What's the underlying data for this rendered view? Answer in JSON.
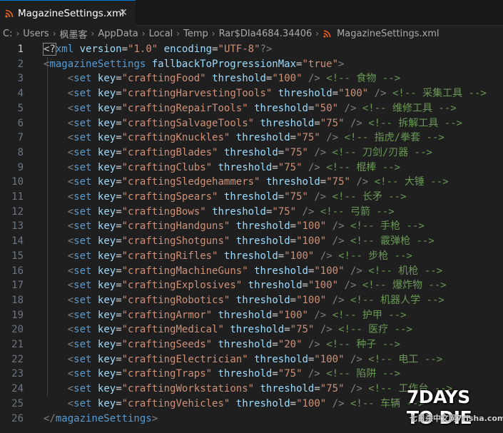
{
  "tab": {
    "title": "MagazineSettings.xml",
    "close_glyph": "✕",
    "icon": "rss-icon",
    "icon_color": "#f26522"
  },
  "breadcrumb": {
    "segments": [
      "C:",
      "Users",
      "枫墨客",
      "AppData",
      "Local",
      "Temp",
      "Rar$DIa4684.34406"
    ],
    "file": "MagazineSettings.xml"
  },
  "editor": {
    "active_line": 1,
    "lines": [
      {
        "n": "1",
        "kind": "decl",
        "decl_open": "<?",
        "decl_name": "xml",
        "attrs": [
          {
            "k": "version",
            "v": "\"1.0\""
          },
          {
            "k": "encoding",
            "v": "\"UTF-8\""
          }
        ],
        "decl_close": "?>"
      },
      {
        "n": "2",
        "kind": "open",
        "indent": "",
        "name": "magazineSettings",
        "attrs": [
          {
            "k": "fallbackToProgressionMax",
            "v": "\"true\""
          }
        ],
        "close": ">"
      },
      {
        "n": "3",
        "kind": "set",
        "key": "\"craftingFood\"",
        "threshold": "\"100\"",
        "comment": "<!-- 食物 -->"
      },
      {
        "n": "4",
        "kind": "set",
        "key": "\"craftingHarvestingTools\"",
        "threshold": "\"100\"",
        "comment": "<!-- 采集工具 -->"
      },
      {
        "n": "5",
        "kind": "set",
        "key": "\"craftingRepairTools\"",
        "threshold": "\"50\"",
        "comment": "<!-- 维修工具 -->"
      },
      {
        "n": "6",
        "kind": "set",
        "key": "\"craftingSalvageTools\"",
        "threshold": "\"75\"",
        "comment": "<!-- 拆解工具 -->"
      },
      {
        "n": "7",
        "kind": "set",
        "key": "\"craftingKnuckles\"",
        "threshold": "\"75\"",
        "comment": "<!-- 指虎/拳套 -->"
      },
      {
        "n": "8",
        "kind": "set",
        "key": "\"craftingBlades\"",
        "threshold": "\"75\"",
        "comment": "<!-- 刀剑/刃器 -->"
      },
      {
        "n": "9",
        "kind": "set",
        "key": "\"craftingClubs\"",
        "threshold": "\"75\"",
        "comment": "<!-- 棍棒 -->"
      },
      {
        "n": "10",
        "kind": "set",
        "key": "\"craftingSledgehammers\"",
        "threshold": "\"75\"",
        "comment": "<!-- 大锤 -->"
      },
      {
        "n": "11",
        "kind": "set",
        "key": "\"craftingSpears\"",
        "threshold": "\"75\"",
        "comment": "<!-- 长矛 -->"
      },
      {
        "n": "12",
        "kind": "set",
        "key": "\"craftingBows\"",
        "threshold": "\"75\"",
        "comment": "<!-- 弓箭 -->"
      },
      {
        "n": "13",
        "kind": "set",
        "key": "\"craftingHandguns\"",
        "threshold": "\"100\"",
        "comment": "<!-- 手枪 -->"
      },
      {
        "n": "14",
        "kind": "set",
        "key": "\"craftingShotguns\"",
        "threshold": "\"100\"",
        "comment": "<!-- 霰弹枪 -->"
      },
      {
        "n": "15",
        "kind": "set",
        "key": "\"craftingRifles\"",
        "threshold": "\"100\"",
        "comment": "<!-- 步枪 -->"
      },
      {
        "n": "16",
        "kind": "set",
        "key": "\"craftingMachineGuns\"",
        "threshold": "\"100\"",
        "comment": "<!-- 机枪 -->"
      },
      {
        "n": "17",
        "kind": "set",
        "key": "\"craftingExplosives\"",
        "threshold": "\"100\"",
        "comment": "<!-- 爆炸物 -->"
      },
      {
        "n": "18",
        "kind": "set",
        "key": "\"craftingRobotics\"",
        "threshold": "\"100\"",
        "comment": "<!-- 机器人学 -->"
      },
      {
        "n": "19",
        "kind": "set",
        "key": "\"craftingArmor\"",
        "threshold": "\"100\"",
        "comment": "<!-- 护甲 -->"
      },
      {
        "n": "20",
        "kind": "set",
        "key": "\"craftingMedical\"",
        "threshold": "\"75\"",
        "comment": "<!-- 医疗 -->"
      },
      {
        "n": "21",
        "kind": "set",
        "key": "\"craftingSeeds\"",
        "threshold": "\"20\"",
        "comment": "<!-- 种子 -->"
      },
      {
        "n": "22",
        "kind": "set",
        "key": "\"craftingElectrician\"",
        "threshold": "\"100\"",
        "comment": "<!-- 电工 -->"
      },
      {
        "n": "23",
        "kind": "set",
        "key": "\"craftingTraps\"",
        "threshold": "\"75\"",
        "comment": "<!-- 陷阱 -->"
      },
      {
        "n": "24",
        "kind": "set",
        "key": "\"craftingWorkstations\"",
        "threshold": "\"75\"",
        "comment": "<!-- 工作台 -->"
      },
      {
        "n": "25",
        "kind": "set",
        "key": "\"craftingVehicles\"",
        "threshold": "\"100\"",
        "comment": "<!-- 车辆 -->"
      },
      {
        "n": "26",
        "kind": "close",
        "indent": "",
        "name": "magazineSettings"
      }
    ]
  },
  "set_tag": {
    "indent": "    ",
    "name": "set",
    "key_attr": "key",
    "threshold_attr": "threshold",
    "self_close": "/>"
  },
  "watermark": {
    "title": "7DAYS TO DIE",
    "subtitle": "七日杀中文网7risha.com"
  },
  "colors": {
    "background": "#1f1f1f",
    "tag": "#569cd6",
    "attribute": "#9cdcfe",
    "string": "#ce9178",
    "comment": "#6a9955",
    "punctuation": "#808080"
  }
}
